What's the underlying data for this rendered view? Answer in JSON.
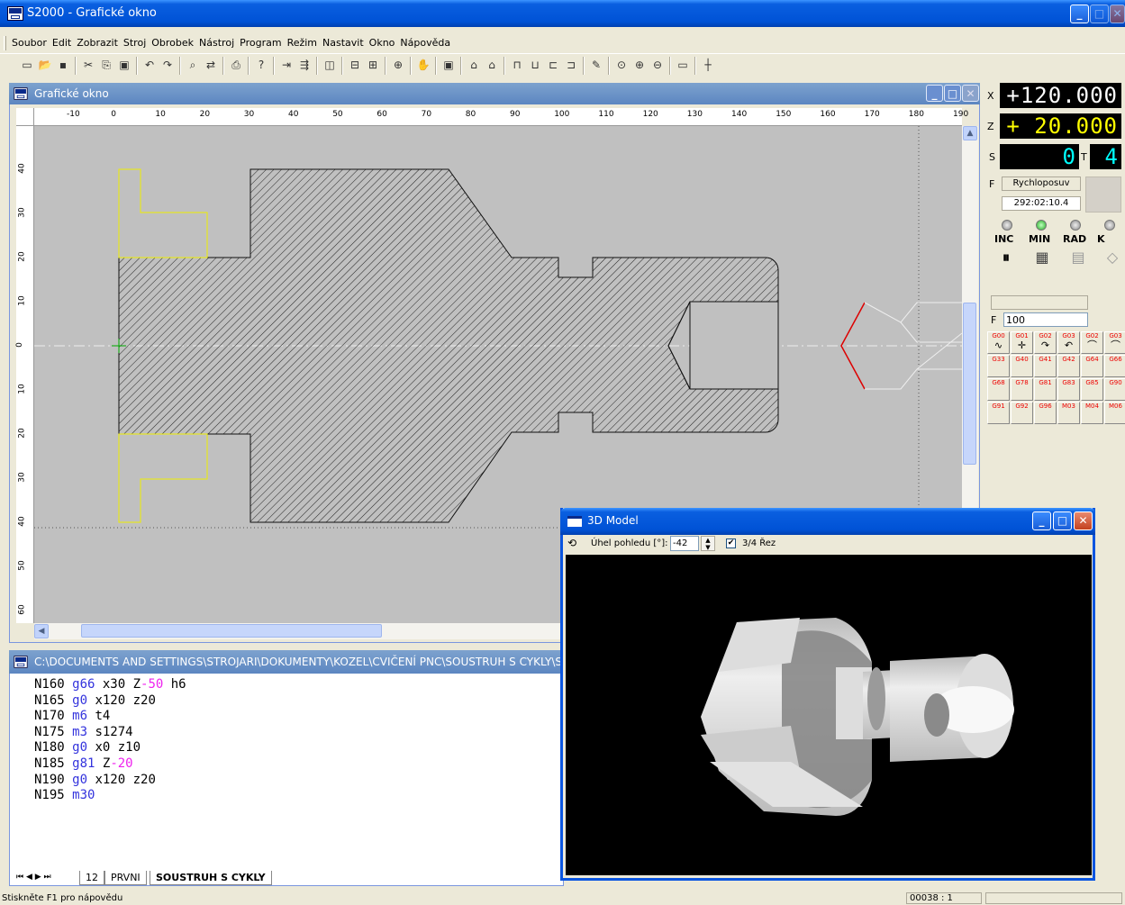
{
  "app": {
    "title": "S2000 - Grafické okno"
  },
  "menu": [
    "Soubor",
    "Edit",
    "Zobrazit",
    "Stroj",
    "Obrobek",
    "Nástroj",
    "Program",
    "Režim",
    "Nastavit",
    "Okno",
    "Nápověda"
  ],
  "graphic_window": {
    "title": "Grafické okno"
  },
  "ruler": {
    "top": [
      "-10",
      "0",
      "10",
      "20",
      "30",
      "40",
      "50",
      "60",
      "70",
      "80",
      "90",
      "100",
      "110",
      "120",
      "130",
      "140",
      "150",
      "160",
      "170",
      "180",
      "190"
    ],
    "left": [
      "40",
      "30",
      "20",
      "10",
      "0",
      "10",
      "20",
      "30",
      "40",
      "50",
      "60"
    ]
  },
  "editor": {
    "title": "C:\\DOCUMENTS AND SETTINGS\\STROJARI\\DOKUMENTY\\KOZEL\\CVIČENÍ PNC\\SOUSTRUH S CYKLY\\SO",
    "lines": [
      [
        [
          "N160 ",
          ""
        ],
        [
          "g66",
          "kw"
        ],
        [
          " x30 Z",
          ""
        ],
        [
          "-50",
          "neg"
        ],
        [
          " h6",
          ""
        ]
      ],
      [
        [
          "N165 ",
          ""
        ],
        [
          "g0",
          "kw"
        ],
        [
          " x120 z20",
          ""
        ]
      ],
      [
        [
          "N170 ",
          ""
        ],
        [
          "m6",
          "kw"
        ],
        [
          " t4",
          ""
        ]
      ],
      [
        [
          "N175 ",
          ""
        ],
        [
          "m3",
          "kw"
        ],
        [
          " s1274",
          ""
        ]
      ],
      [
        [
          "N180 ",
          ""
        ],
        [
          "g0",
          "kw"
        ],
        [
          " x0 z10",
          ""
        ]
      ],
      [
        [
          "N185 ",
          ""
        ],
        [
          "g81",
          "kw"
        ],
        [
          " Z",
          ""
        ],
        [
          "-20",
          "neg"
        ]
      ],
      [
        [
          "N190 ",
          ""
        ],
        [
          "g0",
          "kw"
        ],
        [
          " x120 z20",
          ""
        ]
      ],
      [
        [
          "N195 ",
          ""
        ],
        [
          "m30",
          "kw"
        ]
      ]
    ]
  },
  "tabs": [
    "12",
    "PRVNI",
    "SOUSTRUH S CYKLY"
  ],
  "status": {
    "help": "Stiskněte F1 pro nápovědu",
    "position": "00038 : 1"
  },
  "panel": {
    "x_label": "X",
    "x_value": "+120.000",
    "z_label": "Z",
    "z_value": "+ 20.000",
    "s_label": "S",
    "s_value": "0",
    "t_label": "T",
    "t_value": "4",
    "f_label": "F",
    "mode": "Rychloposuv",
    "time": "292:02:10.4",
    "led_labels": [
      "INC",
      "MIN",
      "RAD",
      "K"
    ],
    "feed_label": "F",
    "feed_value": "100",
    "gcodes": [
      "G00",
      "G01",
      "G02",
      "G03",
      "G02",
      "G03",
      "G33",
      "G40",
      "G41",
      "G42",
      "G64",
      "G66",
      "G68",
      "G78",
      "G81",
      "G83",
      "G85",
      "G90",
      "G91",
      "G92",
      "G96",
      "M03",
      "M04",
      "M06"
    ]
  },
  "model_window": {
    "title": "3D Model",
    "angle_label": "Úhel pohledu [°]:",
    "angle_value": "-42",
    "cut_label": "3/4 Řez",
    "cut_checked": true
  }
}
